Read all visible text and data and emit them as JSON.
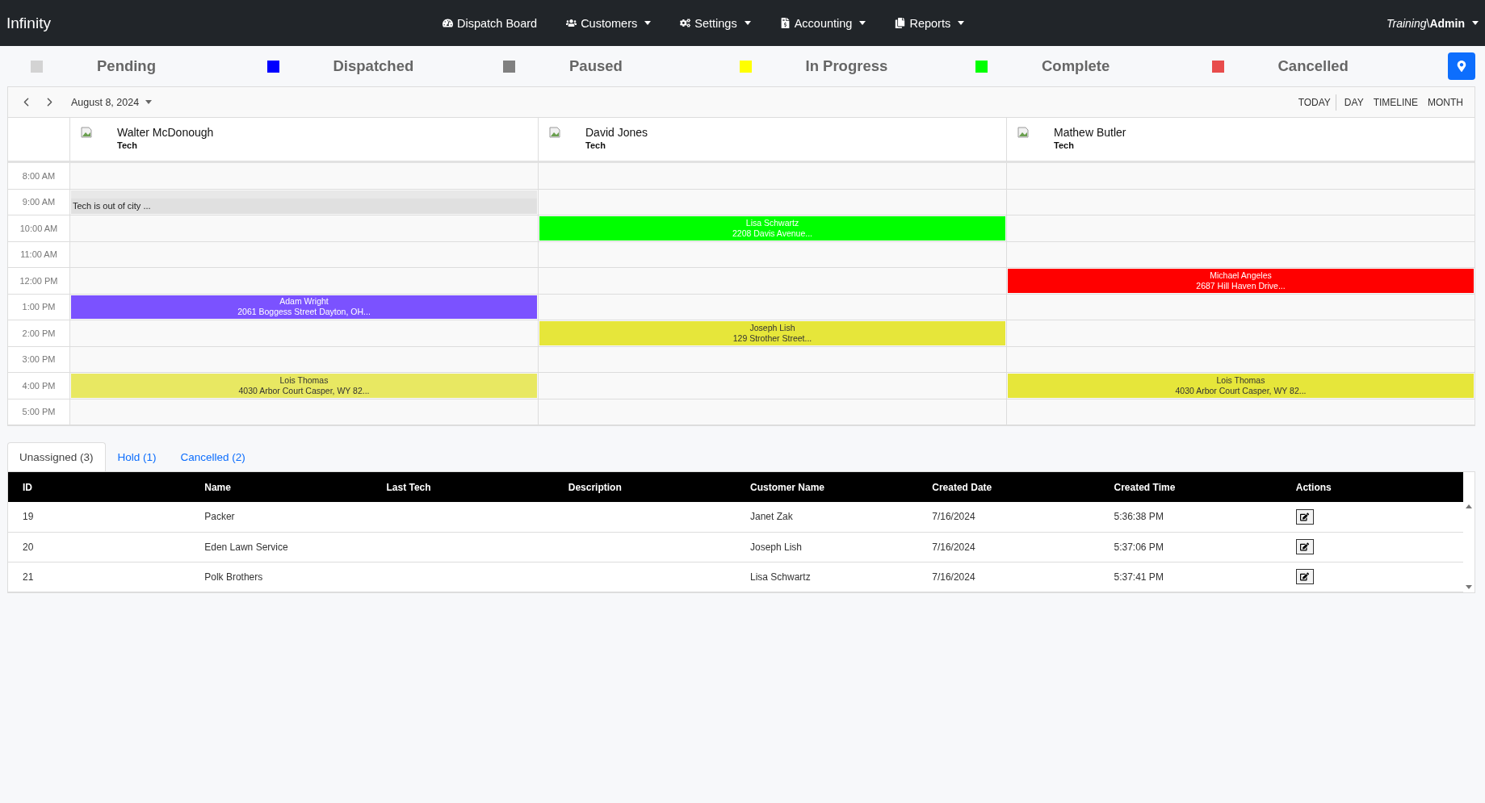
{
  "navbar": {
    "brand": "Infinity",
    "items": [
      {
        "label": "Dispatch Board",
        "dropdown": false
      },
      {
        "label": "Customers",
        "dropdown": true
      },
      {
        "label": "Settings",
        "dropdown": true
      },
      {
        "label": "Accounting",
        "dropdown": true
      },
      {
        "label": "Reports",
        "dropdown": true
      }
    ],
    "user": "*Training*\\**Admin**"
  },
  "legend": [
    {
      "label": "Pending",
      "color": "#d3d3d3"
    },
    {
      "label": "Dispatched",
      "color": "#0000ff"
    },
    {
      "label": "Paused",
      "color": "#808080"
    },
    {
      "label": "In Progress",
      "color": "#ffff00"
    },
    {
      "label": "Complete",
      "color": "#00ff00"
    },
    {
      "label": "Cancelled",
      "color": "#e84c4c"
    }
  ],
  "toolbar": {
    "date": "August 8, 2024",
    "views": [
      "TODAY",
      "DAY",
      "TIMELINE",
      "MONTH"
    ]
  },
  "resources": [
    {
      "name": "Walter McDonough",
      "role": "Tech"
    },
    {
      "name": "David Jones",
      "role": "Tech"
    },
    {
      "name": "Mathew Butler",
      "role": "Tech"
    }
  ],
  "time_rows": [
    {
      "time": "8:00 AM",
      "cells": [
        {
          "kind": "empty"
        },
        {
          "kind": "empty"
        },
        {
          "kind": "empty"
        }
      ]
    },
    {
      "time": "9:00 AM",
      "cells": [
        {
          "kind": "note",
          "text": "Tech is out of city ..."
        },
        {
          "kind": "empty"
        },
        {
          "kind": "empty"
        }
      ]
    },
    {
      "time": "10:00 AM",
      "cells": [
        {
          "kind": "empty"
        },
        {
          "kind": "event",
          "title": "Lisa Schwartz",
          "address": "2208 Davis Avenue...",
          "color": "#00ff00",
          "dark_text": false
        },
        {
          "kind": "empty"
        }
      ]
    },
    {
      "time": "11:00 AM",
      "cells": [
        {
          "kind": "empty"
        },
        {
          "kind": "empty"
        },
        {
          "kind": "empty"
        }
      ]
    },
    {
      "time": "12:00 PM",
      "cells": [
        {
          "kind": "empty"
        },
        {
          "kind": "empty"
        },
        {
          "kind": "event",
          "title": "Michael Angeles",
          "address": "2687 Hill Haven Drive...",
          "color": "#ff0000",
          "dark_text": false
        }
      ]
    },
    {
      "time": "1:00 PM",
      "cells": [
        {
          "kind": "event",
          "title": "Adam Wright",
          "address": "2061 Boggess Street Dayton, OH...",
          "color": "#7b52ff",
          "dark_text": false
        },
        {
          "kind": "empty"
        },
        {
          "kind": "empty"
        }
      ]
    },
    {
      "time": "2:00 PM",
      "cells": [
        {
          "kind": "empty"
        },
        {
          "kind": "event",
          "title": "Joseph Lish",
          "address": "129 Strother Street...",
          "color": "#e6e63a",
          "dark_text": true
        },
        {
          "kind": "empty"
        }
      ]
    },
    {
      "time": "3:00 PM",
      "cells": [
        {
          "kind": "empty"
        },
        {
          "kind": "empty"
        },
        {
          "kind": "empty"
        }
      ]
    },
    {
      "time": "4:00 PM",
      "cells": [
        {
          "kind": "event",
          "title": "Lois Thomas",
          "address": "4030 Arbor Court Casper, WY 82...",
          "color": "#e8e862",
          "dark_text": true
        },
        {
          "kind": "empty"
        },
        {
          "kind": "event",
          "title": "Lois Thomas",
          "address": "4030 Arbor Court Casper, WY 82...",
          "color": "#e6e63a",
          "dark_text": true
        }
      ]
    },
    {
      "time": "5:00 PM",
      "cells": [
        {
          "kind": "empty"
        },
        {
          "kind": "empty"
        },
        {
          "kind": "empty"
        }
      ]
    }
  ],
  "tabs": [
    {
      "label": "Unassigned (3)",
      "selected": true
    },
    {
      "label": "Hold (1)",
      "selected": false
    },
    {
      "label": "Cancelled (2)",
      "selected": false
    }
  ],
  "table": {
    "columns": [
      "ID",
      "Name",
      "Last Tech",
      "Description",
      "Customer Name",
      "Created Date",
      "Created Time",
      "Actions"
    ],
    "rows": [
      {
        "cells": [
          "19",
          "Packer",
          "",
          "",
          "Janet Zak",
          "7/16/2024",
          "5:36:38 PM"
        ]
      },
      {
        "cells": [
          "20",
          "Eden Lawn Service",
          "",
          "",
          "Joseph Lish",
          "7/16/2024",
          "5:37:06 PM"
        ]
      },
      {
        "cells": [
          "21",
          "Polk Brothers",
          "",
          "",
          "Lisa Schwartz",
          "7/16/2024",
          "5:37:41 PM"
        ]
      }
    ]
  }
}
